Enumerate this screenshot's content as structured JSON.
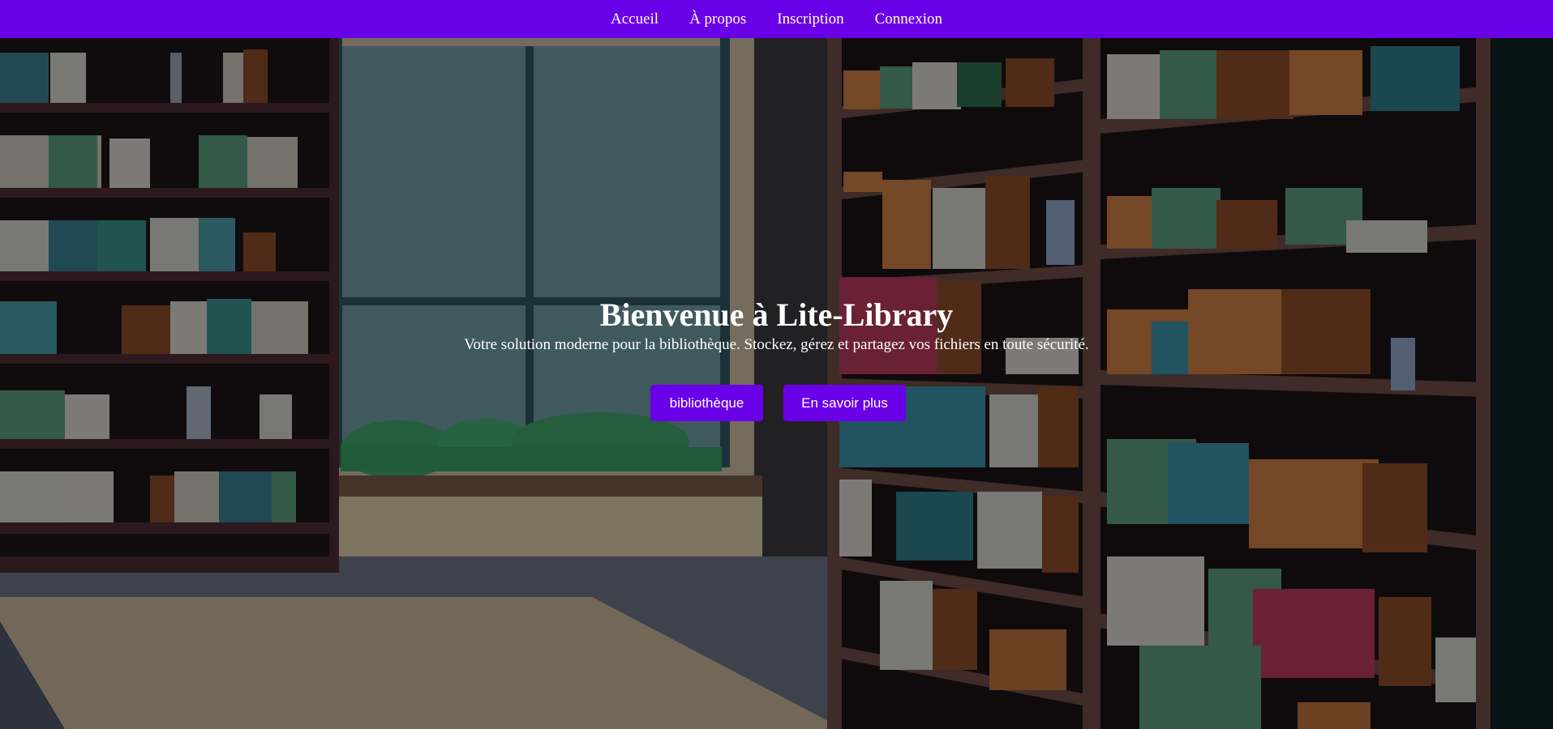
{
  "nav": {
    "items": [
      {
        "label": "Accueil"
      },
      {
        "label": "À propos"
      },
      {
        "label": "Inscription"
      },
      {
        "label": "Connexion"
      }
    ]
  },
  "hero": {
    "title": "Bienvenue à Lite-Library",
    "subtitle": "Votre solution moderne pour la bibliothèque. Stockez, gérez et partagez vos fichiers en toute sécurité.",
    "buttons": {
      "primary_label": "bibliothèque",
      "secondary_label": "En savoir plus"
    },
    "background": "library-bookshelves-illustration"
  },
  "colors": {
    "accent": "#6a00e8",
    "text": "#ffffff"
  }
}
